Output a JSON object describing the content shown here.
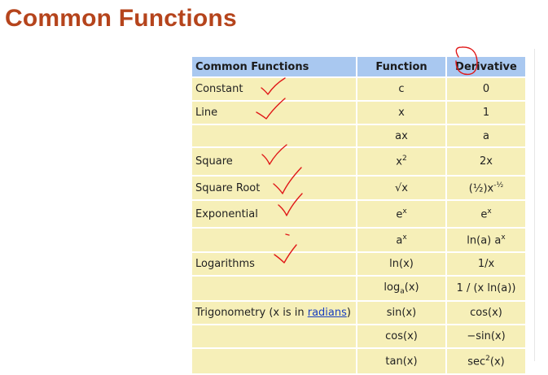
{
  "slide": {
    "title": "Common Functions"
  },
  "table": {
    "headers": [
      "Common Functions",
      "Function",
      "Derivative"
    ],
    "rows": [
      {
        "name": "Constant",
        "fn": "c",
        "deriv": "0"
      },
      {
        "name": "Line",
        "fn": "x",
        "deriv": "1"
      },
      {
        "name": "",
        "fn": "ax",
        "deriv": "a"
      },
      {
        "name": "Square",
        "fn_base": "x",
        "fn_sup": "2",
        "deriv": "2x"
      },
      {
        "name": "Square Root",
        "fn": "√x",
        "deriv_base": "(½)x",
        "deriv_sup": "-½"
      },
      {
        "name": "Exponential",
        "fn_base": "e",
        "fn_sup": "x",
        "deriv_base": "e",
        "deriv_sup": "x"
      },
      {
        "name": "",
        "fn_base": "a",
        "fn_sup": "x",
        "deriv_base": "ln(a) a",
        "deriv_sup": "x"
      },
      {
        "name": "Logarithms",
        "fn": "ln(x)",
        "deriv": "1/x"
      },
      {
        "name": "",
        "fn_pre": "log",
        "fn_sub": "a",
        "fn_post": "(x)",
        "deriv": "1 / (x ln(a))"
      },
      {
        "name_pre": "Trigonometry (x is in ",
        "name_link": "radians",
        "name_post": ")",
        "fn": "sin(x)",
        "deriv": "cos(x)"
      },
      {
        "name": "",
        "fn": "cos(x)",
        "deriv": "−sin(x)"
      },
      {
        "name": "",
        "fn": "tan(x)",
        "deriv_base": "sec",
        "deriv_sup": "2",
        "deriv_post": "(x)"
      }
    ]
  },
  "annotations": {
    "ink_color": "#e01818"
  }
}
